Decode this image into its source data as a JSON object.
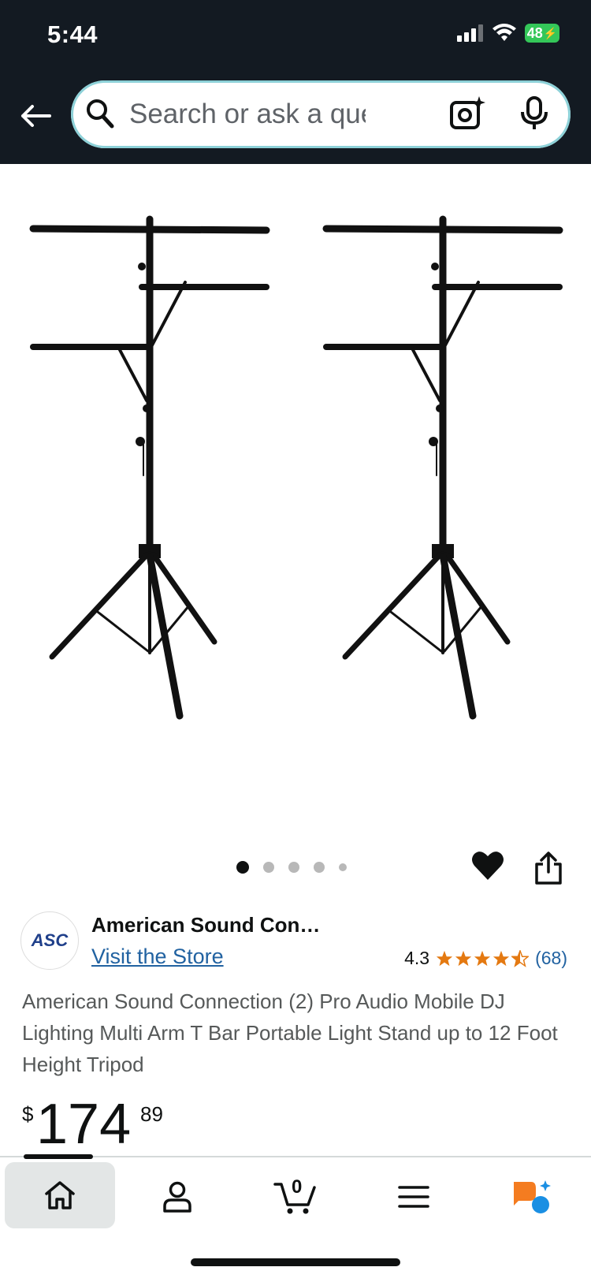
{
  "status": {
    "time": "5:44",
    "battery": "48"
  },
  "search": {
    "placeholder": "Search or ask a que…"
  },
  "product": {
    "image_alt": "Two black multi-arm T-bar lighting tripod stands",
    "carousel": {
      "count": 5,
      "active": 0
    },
    "brand": {
      "logo_text": "ASC",
      "name": "American Sound Con…",
      "store_link": "Visit the Store"
    },
    "rating": {
      "value": "4.3",
      "count": "(68)",
      "stars": 4.3
    },
    "title": "American Sound Connection (2) Pro Audio Mobile DJ Lighting Multi Arm T Bar Portable Light Stand up to 12 Foot Height Tripod",
    "price": {
      "symbol": "$",
      "whole": "174",
      "fraction": "89"
    }
  },
  "nav": {
    "items": [
      {
        "name": "home",
        "icon": "home-icon"
      },
      {
        "name": "account",
        "icon": "user-icon"
      },
      {
        "name": "cart",
        "icon": "cart-icon",
        "count": "0"
      },
      {
        "name": "menu",
        "icon": "menu-icon"
      },
      {
        "name": "rufus",
        "icon": "assistant-icon"
      }
    ]
  },
  "colors": {
    "header_bg": "#131a22",
    "link": "#2162a1",
    "star": "#e47911",
    "search_ring": "#8dd1d8"
  }
}
